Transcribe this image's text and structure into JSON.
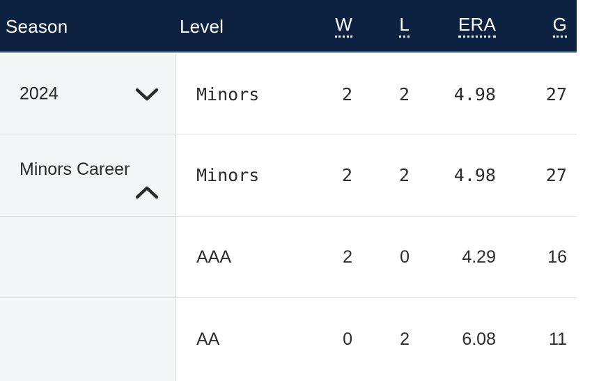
{
  "table": {
    "columns": [
      {
        "key": "season",
        "label": "Season",
        "align": "left",
        "underline": false
      },
      {
        "key": "level",
        "label": "Level",
        "align": "left",
        "underline": false
      },
      {
        "key": "w",
        "label": "W",
        "align": "right",
        "underline": true
      },
      {
        "key": "l",
        "label": "L",
        "align": "right",
        "underline": true
      },
      {
        "key": "era",
        "label": "ERA",
        "align": "right",
        "underline": true
      },
      {
        "key": "g",
        "label": "G",
        "align": "right",
        "underline": true
      }
    ],
    "header": {
      "season": "Season",
      "level": "Level",
      "w": "W",
      "l": "L",
      "era": "ERA",
      "g": "G"
    },
    "rows": [
      {
        "season": "2024",
        "toggle_icon": "chevron-down-icon",
        "level": "Minors",
        "w": "2",
        "l": "2",
        "era": "4.98",
        "g": "27"
      },
      {
        "season": "Minors Career",
        "toggle_icon": "chevron-up-icon",
        "level": "Minors",
        "w": "2",
        "l": "2",
        "era": "4.98",
        "g": "27"
      },
      {
        "season": "",
        "toggle_icon": "",
        "level": "AAA",
        "w": "2",
        "l": "0",
        "era": "4.29",
        "g": "16"
      },
      {
        "season": "",
        "toggle_icon": "",
        "level": "AA",
        "w": "0",
        "l": "2",
        "era": "6.08",
        "g": "11"
      }
    ]
  },
  "colors": {
    "header_background": "#0d2240",
    "header_text": "#ffffff",
    "header_accent_rule": "#7fa8c9",
    "season_column_background": "#f4f5f6",
    "row_divider": "#dcdedf",
    "body_text": "#2c2c2c",
    "page_background": "#ffffff"
  }
}
